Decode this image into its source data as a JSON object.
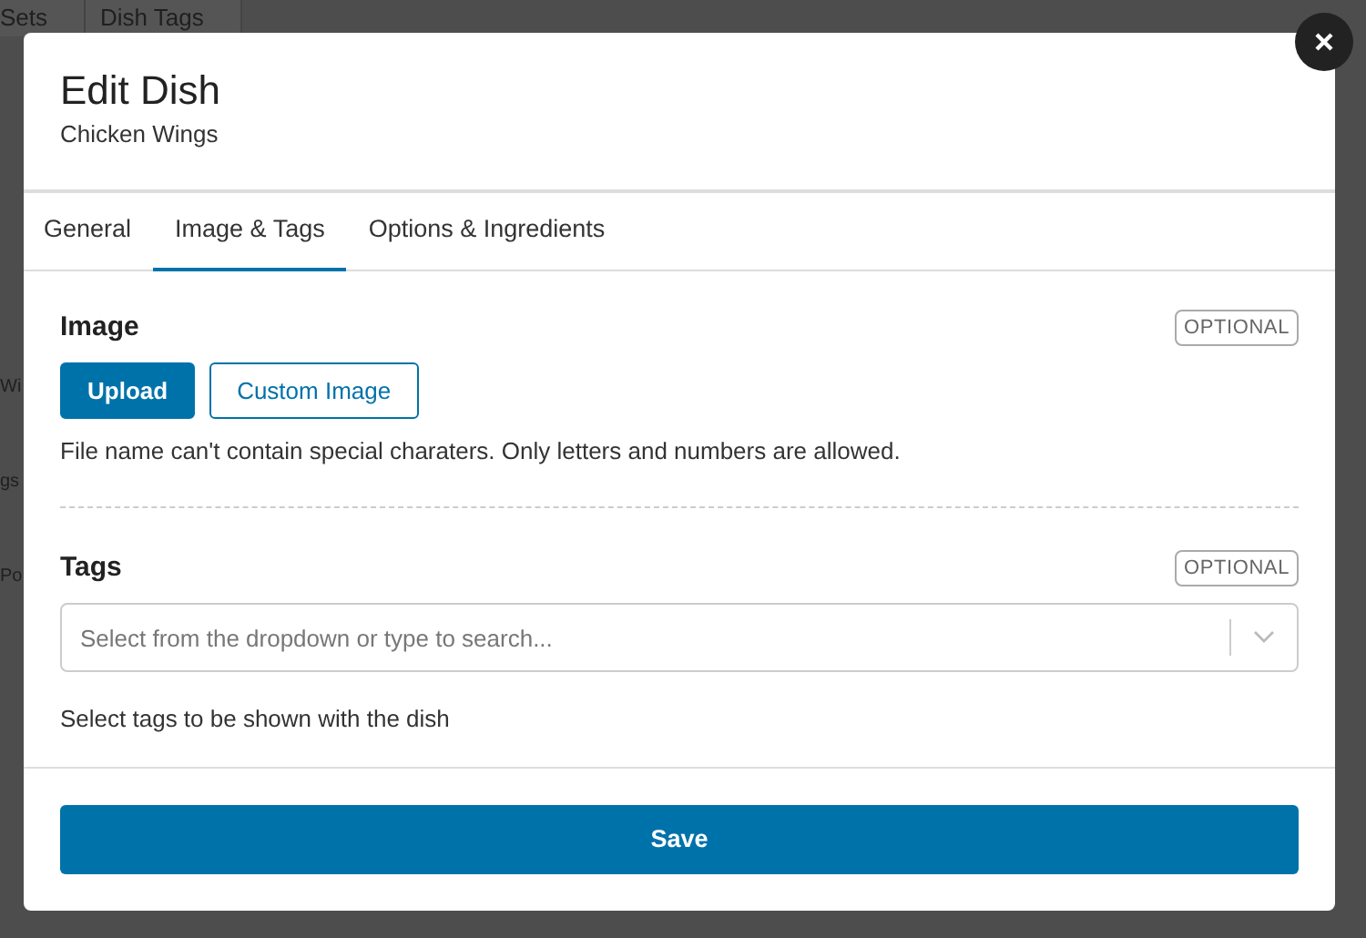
{
  "background": {
    "tabs": [
      "Sets",
      "Dish Tags"
    ],
    "rows": [
      "Wi",
      "gs",
      "Po"
    ]
  },
  "modal": {
    "title": "Edit Dish",
    "subtitle": "Chicken Wings",
    "tabs": [
      {
        "label": "General",
        "selected": false
      },
      {
        "label": "Image & Tags",
        "selected": true
      },
      {
        "label": "Options & Ingredients",
        "selected": false
      }
    ],
    "image": {
      "label": "Image",
      "badge": "OPTIONAL",
      "buttons": [
        {
          "label": "Upload",
          "kind": "primary"
        },
        {
          "label": "Custom Image",
          "kind": "outline"
        }
      ],
      "help": "File name can't contain special charaters. Only letters and numbers are allowed."
    },
    "tags": {
      "label": "Tags",
      "badge": "OPTIONAL",
      "placeholder": "Select from the dropdown or type to search...",
      "help": "Select tags to be shown with the dish"
    },
    "save": "Save"
  }
}
